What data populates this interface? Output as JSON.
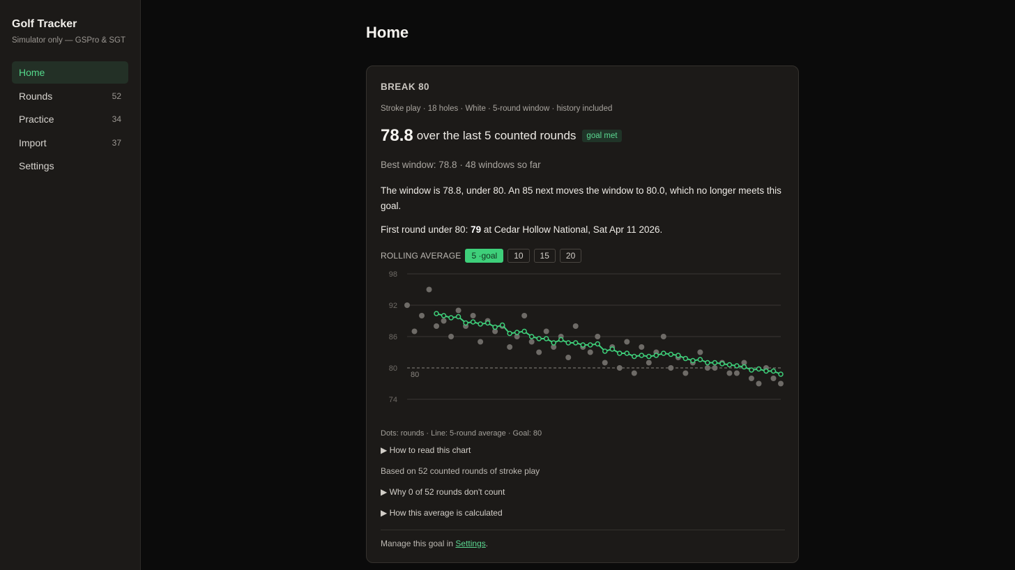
{
  "sidebar": {
    "title": "Golf Tracker",
    "subtitle": "Simulator only — GSPro & SGT",
    "items": [
      {
        "label": "Home",
        "count": ""
      },
      {
        "label": "Rounds",
        "count": "52"
      },
      {
        "label": "Practice",
        "count": "34"
      },
      {
        "label": "Import",
        "count": "37"
      },
      {
        "label": "Settings",
        "count": ""
      }
    ]
  },
  "page": {
    "title": "Home"
  },
  "goal": {
    "name": "BREAK 80",
    "meta": "Stroke play · 18 holes · White · 5-round window · history included",
    "headline_value": "78.8",
    "headline_text": "over the last 5 counted rounds",
    "badge": "goal met",
    "best": "Best window: 78.8 · 48 windows so far",
    "explanation": "The window is 78.8, under 80. An 85 next moves the window to 80.0, which no longer meets this goal.",
    "first_round_prefix": "First round under 80:",
    "first_round_score": "79",
    "first_round_suffix": "at Cedar Hollow National, Sat Apr 11 2026.",
    "rolling_label": "ROLLING AVERAGE",
    "rolling_options": [
      "5 ·goal",
      "10",
      "15",
      "20"
    ],
    "legend": "Dots: rounds · Line: 5-round average · Goal: 80",
    "how_to_read": "▶ How to read this chart",
    "based_on": "Based on 52 counted rounds of stroke play",
    "why_not_count": "▶ Why 0 of 52 rounds don't count",
    "how_calculated": "▶ How this average is calculated",
    "manage_prefix": "Manage this goal in",
    "manage_link": "Settings",
    "manage_suffix": "."
  },
  "colors": {
    "accent": "#3ecf7a",
    "rounds_dots": "#6e6b67",
    "background": "#0b0b0b",
    "card": "#1c1a18"
  },
  "chart_data": {
    "type": "scatter",
    "ylim": [
      74,
      98
    ],
    "yticks": [
      "98",
      "92",
      "86",
      "80",
      "74"
    ],
    "goal_line": 80,
    "goal_label": "80",
    "x": [
      1,
      2,
      3,
      4,
      5,
      6,
      7,
      8,
      9,
      10,
      11,
      12,
      13,
      14,
      15,
      16,
      17,
      18,
      19,
      20,
      21,
      22,
      23,
      24,
      25,
      26,
      27,
      28,
      29,
      30,
      31,
      32,
      33,
      34,
      35,
      36,
      37,
      38,
      39,
      40,
      41,
      42,
      43,
      44,
      45,
      46,
      47,
      48,
      49,
      50,
      51,
      52
    ],
    "series": [
      {
        "values": [
          92,
          87,
          90,
          95,
          88,
          89,
          86,
          91,
          88,
          90,
          85,
          89,
          87,
          88,
          84,
          86,
          90,
          85,
          83,
          87,
          84,
          86,
          82,
          88,
          84,
          83,
          86,
          81,
          84,
          80,
          85,
          79,
          84,
          81,
          83,
          86,
          80,
          82,
          79,
          81,
          83,
          80,
          80,
          81,
          79,
          79,
          81,
          78,
          77,
          80,
          78,
          77
        ]
      },
      {
        "values": [
          null,
          null,
          null,
          null,
          90.4,
          90.0,
          89.6,
          89.8,
          88.6,
          88.8,
          88.4,
          88.6,
          87.8,
          88.2,
          86.6,
          86.8,
          87.0,
          86.0,
          85.6,
          85.6,
          84.8,
          85.4,
          84.8,
          84.8,
          84.4,
          84.4,
          84.6,
          83.2,
          83.6,
          82.8,
          82.8,
          82.2,
          82.4,
          82.2,
          82.4,
          82.8,
          82.6,
          82.4,
          81.8,
          81.4,
          81.6,
          81.0,
          81.0,
          80.8,
          80.6,
          80.4,
          80.2,
          79.6,
          79.8,
          79.4,
          79.4,
          78.8
        ]
      }
    ]
  }
}
